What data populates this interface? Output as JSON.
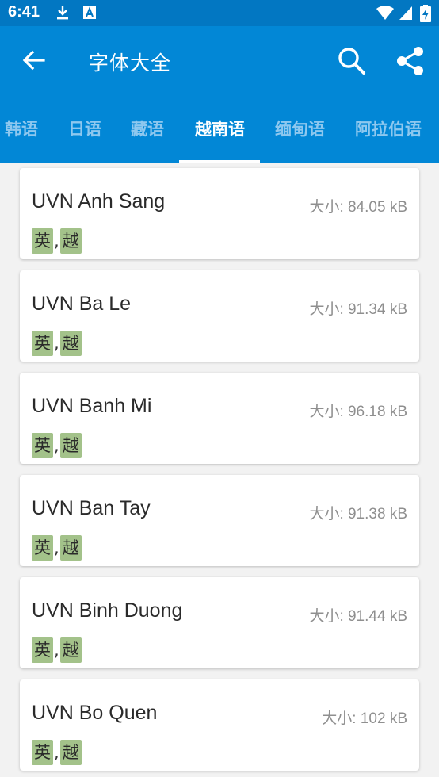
{
  "status": {
    "time": "6:41"
  },
  "appbar": {
    "title": "字体大全"
  },
  "tabs": [
    {
      "label": "韩语"
    },
    {
      "label": "日语"
    },
    {
      "label": "藏语"
    },
    {
      "label": "越南语",
      "active": true
    },
    {
      "label": "缅甸语"
    },
    {
      "label": "阿拉伯语"
    }
  ],
  "fonts": [
    {
      "name": "UVN Anh Sang",
      "size": "大小: 84.05 kB",
      "tag1": "英",
      "sep": ",",
      "tag2": "越"
    },
    {
      "name": "UVN Ba Le",
      "size": "大小: 91.34 kB",
      "tag1": "英",
      "sep": ",",
      "tag2": "越"
    },
    {
      "name": "UVN Banh Mi",
      "size": "大小: 96.18 kB",
      "tag1": "英",
      "sep": ",",
      "tag2": "越"
    },
    {
      "name": "UVN Ban Tay",
      "size": "大小: 91.38 kB",
      "tag1": "英",
      "sep": ",",
      "tag2": "越"
    },
    {
      "name": "UVN Binh Duong",
      "size": "大小: 91.44 kB",
      "tag1": "英",
      "sep": ",",
      "tag2": "越"
    },
    {
      "name": "UVN Bo Quen",
      "size": "大小: 102 kB",
      "tag1": "英",
      "sep": ",",
      "tag2": "越"
    }
  ],
  "colors": {
    "appbar": "#0287d6",
    "statusbar": "#0277c2",
    "tag": "#a3c28a"
  }
}
